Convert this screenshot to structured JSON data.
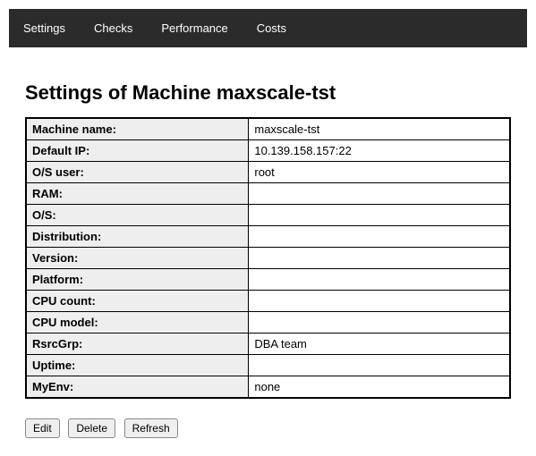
{
  "nav": {
    "items": [
      "Settings",
      "Checks",
      "Performance",
      "Costs"
    ]
  },
  "page": {
    "title": "Settings of Machine maxscale-tst"
  },
  "details": {
    "rows": [
      {
        "label": "Machine name:",
        "value": "maxscale-tst"
      },
      {
        "label": "Default IP:",
        "value": "10.139.158.157:22"
      },
      {
        "label": "O/S user:",
        "value": "root"
      },
      {
        "label": "RAM:",
        "value": ""
      },
      {
        "label": "O/S:",
        "value": ""
      },
      {
        "label": "Distribution:",
        "value": ""
      },
      {
        "label": "Version:",
        "value": ""
      },
      {
        "label": "Platform:",
        "value": ""
      },
      {
        "label": "CPU count:",
        "value": ""
      },
      {
        "label": "CPU model:",
        "value": ""
      },
      {
        "label": "RsrcGrp:",
        "value": "DBA team"
      },
      {
        "label": "Uptime:",
        "value": ""
      },
      {
        "label": "MyEnv:",
        "value": "none"
      }
    ]
  },
  "buttons": {
    "edit": "Edit",
    "delete": "Delete",
    "refresh": "Refresh"
  }
}
